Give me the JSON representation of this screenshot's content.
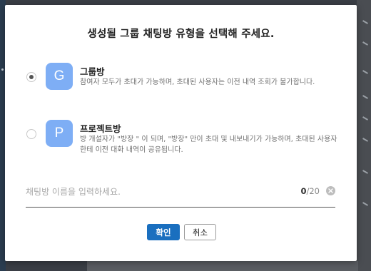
{
  "dialog": {
    "title": "생성될 그룹 채팅방 유형을 선택해 주세요."
  },
  "options": [
    {
      "avatar_letter": "G",
      "name": "그룹방",
      "description": "참여자 모두가 초대가 가능하며, 초대된 사용자는 이전 내역 조회가 불가합니다.",
      "selected": true
    },
    {
      "avatar_letter": "P",
      "name": "프로젝트방",
      "description": "방 개설자가 \"방장 \" 이 되며, \"방장\" 만이 초대 및 내보내기가 가능하며, 초대된 사용자 한테 이전 대화 내역이 공유됩니다.",
      "selected": false
    }
  ],
  "name_input": {
    "placeholder": "채팅방 이름을 입력하세요.",
    "value": "",
    "count_current": "0",
    "count_max": "/20"
  },
  "buttons": {
    "confirm": "확인",
    "cancel": "취소"
  },
  "colors": {
    "accent": "#1a6fbf",
    "avatar": "#7eaef5",
    "backdrop": "#3a3e45"
  }
}
